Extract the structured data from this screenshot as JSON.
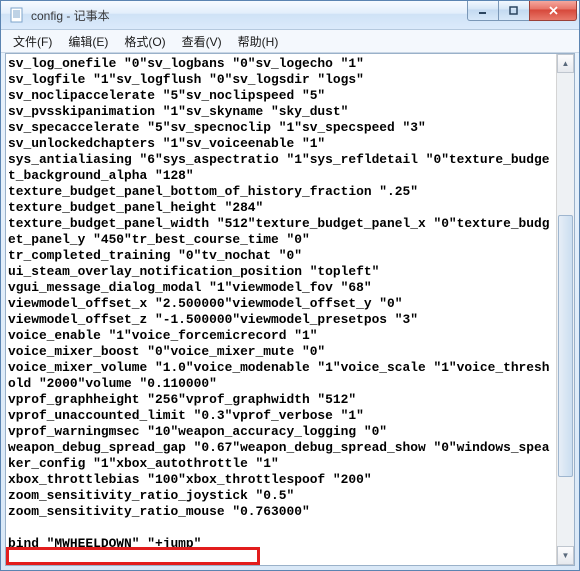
{
  "window": {
    "title": "config - 记事本"
  },
  "menu": {
    "file": "文件(F)",
    "edit": "编辑(E)",
    "format": "格式(O)",
    "view": "查看(V)",
    "help": "帮助(H)"
  },
  "body_text": "sv_log_onefile \"0\"sv_logbans \"0\"sv_logecho \"1\"\nsv_logfile \"1\"sv_logflush \"0\"sv_logsdir \"logs\"\nsv_noclipaccelerate \"5\"sv_noclipspeed \"5\"\nsv_pvsskipanimation \"1\"sv_skyname \"sky_dust\"\nsv_specaccelerate \"5\"sv_specnoclip \"1\"sv_specspeed \"3\"\nsv_unlockedchapters \"1\"sv_voiceenable \"1\"\nsys_antialiasing \"6\"sys_aspectratio \"1\"sys_refldetail \"0\"texture_budget_background_alpha \"128\"\ntexture_budget_panel_bottom_of_history_fraction \".25\"\ntexture_budget_panel_height \"284\"\ntexture_budget_panel_width \"512\"texture_budget_panel_x \"0\"texture_budget_panel_y \"450\"tr_best_course_time \"0\"\ntr_completed_training \"0\"tv_nochat \"0\"\nui_steam_overlay_notification_position \"topleft\"\nvgui_message_dialog_modal \"1\"viewmodel_fov \"68\"\nviewmodel_offset_x \"2.500000\"viewmodel_offset_y \"0\"\nviewmodel_offset_z \"-1.500000\"viewmodel_presetpos \"3\"\nvoice_enable \"1\"voice_forcemicrecord \"1\"\nvoice_mixer_boost \"0\"voice_mixer_mute \"0\"\nvoice_mixer_volume \"1.0\"voice_modenable \"1\"voice_scale \"1\"voice_threshold \"2000\"volume \"0.110000\"\nvprof_graphheight \"256\"vprof_graphwidth \"512\"\nvprof_unaccounted_limit \"0.3\"vprof_verbose \"1\"\nvprof_warningmsec \"10\"weapon_accuracy_logging \"0\"\nweapon_debug_spread_gap \"0.67\"weapon_debug_spread_show \"0\"windows_speaker_config \"1\"xbox_autothrottle \"1\"\nxbox_throttlebias \"100\"xbox_throttlespoof \"200\"\nzoom_sensitivity_ratio_joystick \"0.5\"\nzoom_sensitivity_ratio_mouse \"0.763000\"\n\nbind \"MWHEELDOWN\" \"+jump\""
}
